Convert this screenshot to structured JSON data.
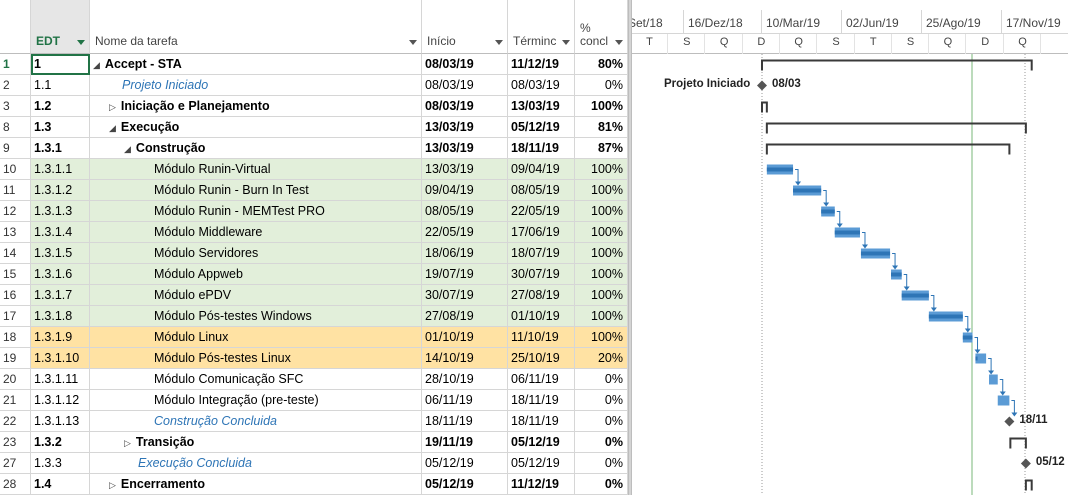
{
  "headers": {
    "edt": "EDT",
    "name": "Nome da tarefa",
    "start": "Início",
    "finish": "Términc",
    "pct_line1": "%",
    "pct_line2": "concl"
  },
  "timeline": {
    "top_dates": [
      "Set/18",
      "16/Dez/18",
      "10/Mar/19",
      "02/Jun/19",
      "25/Ago/19",
      "17/Nov/19"
    ],
    "day_letters": [
      "T",
      "S",
      "Q",
      "D",
      "Q",
      "S",
      "T",
      "S",
      "Q",
      "D",
      "Q"
    ]
  },
  "rows": [
    {
      "num": "1",
      "edt": "1",
      "name": "Accept - STA",
      "start": "08/03/19",
      "finish": "11/12/19",
      "pct": "80%",
      "style": "bold",
      "indent": 0,
      "tri": "◢",
      "sel": true
    },
    {
      "num": "2",
      "edt": "1.1",
      "name": "Projeto Iniciado",
      "start": "08/03/19",
      "finish": "08/03/19",
      "pct": "0%",
      "style": "ms",
      "indent": 1
    },
    {
      "num": "3",
      "edt": "1.2",
      "name": "Iniciação e Planejamento",
      "start": "08/03/19",
      "finish": "13/03/19",
      "pct": "100%",
      "style": "bold",
      "indent": 1,
      "tri": "▷"
    },
    {
      "num": "8",
      "edt": "1.3",
      "name": "Execução",
      "start": "13/03/19",
      "finish": "05/12/19",
      "pct": "81%",
      "style": "bold",
      "indent": 1,
      "tri": "◢"
    },
    {
      "num": "9",
      "edt": "1.3.1",
      "name": "Construção",
      "start": "13/03/19",
      "finish": "18/11/19",
      "pct": "87%",
      "style": "bold",
      "indent": 2,
      "tri": "◢"
    },
    {
      "num": "10",
      "edt": "1.3.1.1",
      "name": "Módulo Runin-Virtual",
      "start": "13/03/19",
      "finish": "09/04/19",
      "pct": "100%",
      "style": "green",
      "indent": 3
    },
    {
      "num": "11",
      "edt": "1.3.1.2",
      "name": "Módulo Runin - Burn In Test",
      "start": "09/04/19",
      "finish": "08/05/19",
      "pct": "100%",
      "style": "green",
      "indent": 3
    },
    {
      "num": "12",
      "edt": "1.3.1.3",
      "name": "Módulo Runin - MEMTest PRO",
      "start": "08/05/19",
      "finish": "22/05/19",
      "pct": "100%",
      "style": "green",
      "indent": 3
    },
    {
      "num": "13",
      "edt": "1.3.1.4",
      "name": "Módulo Middleware",
      "start": "22/05/19",
      "finish": "17/06/19",
      "pct": "100%",
      "style": "green",
      "indent": 3
    },
    {
      "num": "14",
      "edt": "1.3.1.5",
      "name": "Módulo Servidores",
      "start": "18/06/19",
      "finish": "18/07/19",
      "pct": "100%",
      "style": "green",
      "indent": 3
    },
    {
      "num": "15",
      "edt": "1.3.1.6",
      "name": "Módulo Appweb",
      "start": "19/07/19",
      "finish": "30/07/19",
      "pct": "100%",
      "style": "green",
      "indent": 3
    },
    {
      "num": "16",
      "edt": "1.3.1.7",
      "name": "Módulo ePDV",
      "start": "30/07/19",
      "finish": "27/08/19",
      "pct": "100%",
      "style": "green",
      "indent": 3
    },
    {
      "num": "17",
      "edt": "1.3.1.8",
      "name": "Módulo Pós-testes Windows",
      "start": "27/08/19",
      "finish": "01/10/19",
      "pct": "100%",
      "style": "green",
      "indent": 3
    },
    {
      "num": "18",
      "edt": "1.3.1.9",
      "name": "Módulo Linux",
      "start": "01/10/19",
      "finish": "11/10/19",
      "pct": "100%",
      "style": "orange",
      "indent": 3
    },
    {
      "num": "19",
      "edt": "1.3.1.10",
      "name": "Módulo Pós-testes Linux",
      "start": "14/10/19",
      "finish": "25/10/19",
      "pct": "20%",
      "style": "orange",
      "indent": 3
    },
    {
      "num": "20",
      "edt": "1.3.1.11",
      "name": "Módulo Comunicação SFC",
      "start": "28/10/19",
      "finish": "06/11/19",
      "pct": "0%",
      "style": "plain",
      "indent": 3
    },
    {
      "num": "21",
      "edt": "1.3.1.12",
      "name": "Módulo Integração (pre-teste)",
      "start": "06/11/19",
      "finish": "18/11/19",
      "pct": "0%",
      "style": "plain",
      "indent": 3
    },
    {
      "num": "22",
      "edt": "1.3.1.13",
      "name": "Construção Concluida",
      "start": "18/11/19",
      "finish": "18/11/19",
      "pct": "0%",
      "style": "ms",
      "indent": 3
    },
    {
      "num": "23",
      "edt": "1.3.2",
      "name": "Transição",
      "start": "19/11/19",
      "finish": "05/12/19",
      "pct": "0%",
      "style": "bold",
      "indent": 2,
      "tri": "▷"
    },
    {
      "num": "27",
      "edt": "1.3.3",
      "name": "Execução Concluida",
      "start": "05/12/19",
      "finish": "05/12/19",
      "pct": "0%",
      "style": "ms",
      "indent": 2
    },
    {
      "num": "28",
      "edt": "1.4",
      "name": "Encerramento",
      "start": "05/12/19",
      "finish": "11/12/19",
      "pct": "0%",
      "style": "bold",
      "indent": 1,
      "tri": "▷"
    }
  ],
  "gantt_labels": {
    "projeto_iniciado": "Projeto Iniciado",
    "projeto_iniciado_date": "08/03",
    "construcao_date": "18/11",
    "execucao_date": "05/12"
  },
  "colors": {
    "edt_green": "#217346",
    "done_row": "#e2efda",
    "warn_row": "#ffe2a3",
    "milestone_text": "#2e75b6",
    "bar": "#5b9bd5",
    "bar_progress": "#2e75b6"
  }
}
